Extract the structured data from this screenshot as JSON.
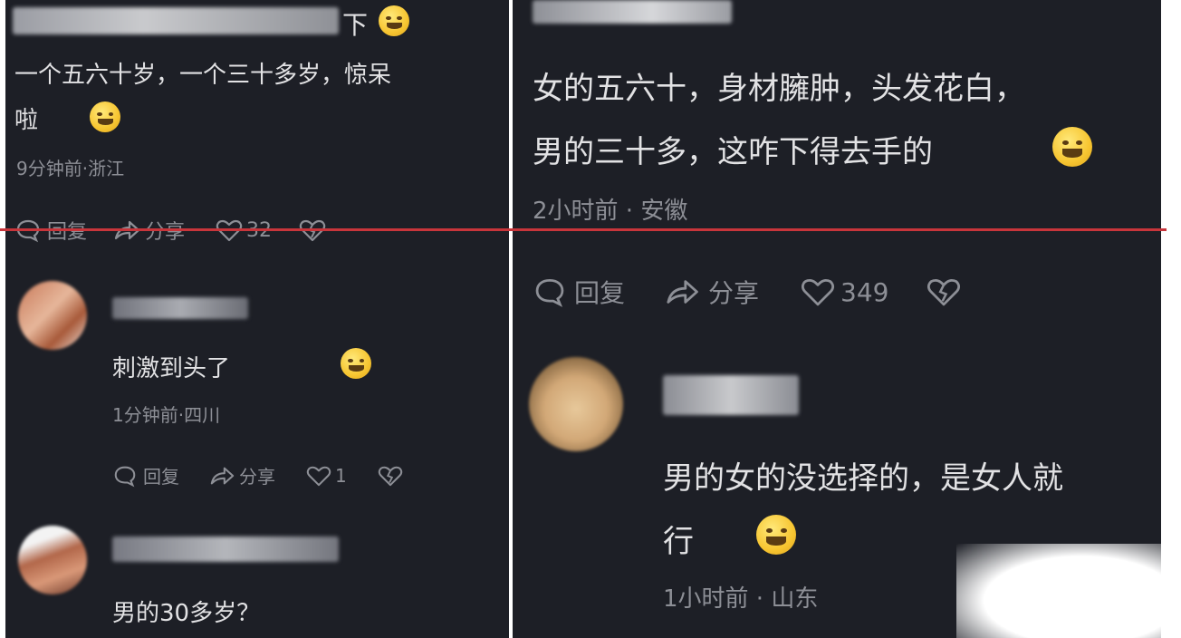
{
  "left": {
    "top_comment": {
      "partial_text": "下",
      "line1": "一个五六十岁，一个三十多岁，惊呆",
      "line2": "啦",
      "meta": "9分钟前·浙江",
      "actions": {
        "reply": "回复",
        "share": "分享",
        "likes": "32"
      }
    },
    "comment2": {
      "text": "刺激到头了",
      "meta": "1分钟前·四川",
      "actions": {
        "reply": "回复",
        "share": "分享",
        "likes": "1"
      }
    },
    "comment3": {
      "text": "男的30多岁？"
    }
  },
  "right": {
    "top_comment": {
      "line1": "女的五六十，身材臃肿，头发花白，",
      "line2": "男的三十多，这咋下得去手的",
      "meta": "2小时前 · 安徽",
      "actions": {
        "reply": "回复",
        "share": "分享",
        "likes": "349"
      }
    },
    "comment2": {
      "line1": "男的女的没选择的，是女人就",
      "line2": "行",
      "meta": "1小时前 · 山东"
    }
  },
  "colors": {
    "background": "#1d1f26",
    "text": "#e2e2e4",
    "meta": "#8d8f96",
    "red_line": "#c8353b"
  },
  "icons": [
    "comment-icon",
    "share-icon",
    "heart-icon",
    "dislike-icon",
    "emoji-icon"
  ]
}
